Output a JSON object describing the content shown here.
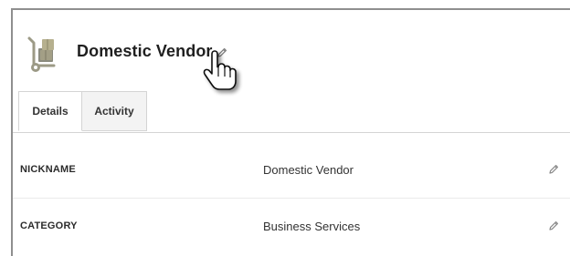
{
  "header": {
    "vendor_name": "Domestic Vendor",
    "vendor_icon": "hand-truck-boxes-icon",
    "edit_icon": "pencil-icon"
  },
  "tabs": [
    {
      "label": "Details",
      "active": true
    },
    {
      "label": "Activity",
      "active": false
    }
  ],
  "fields": [
    {
      "label": "NICKNAME",
      "value": "Domestic Vendor",
      "edit_icon": "pencil-icon"
    },
    {
      "label": "CATEGORY",
      "value": "Business Services",
      "edit_icon": "pencil-icon"
    }
  ],
  "cursor": "hand-pointer-icon"
}
